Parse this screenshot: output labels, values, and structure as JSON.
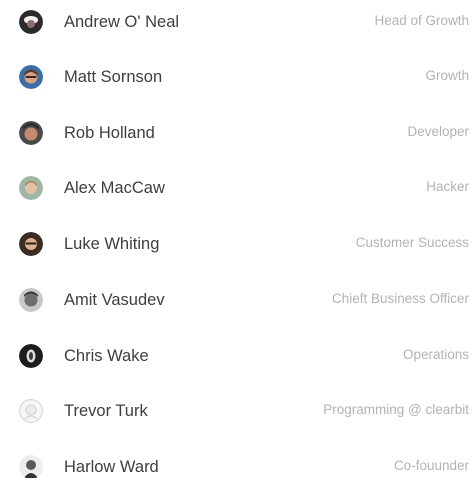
{
  "team": {
    "members": [
      {
        "name": "Andrew O' Neal",
        "role": "Head of Growth",
        "avatar_icon": "andrew-avatar"
      },
      {
        "name": "Matt Sornson",
        "role": "Growth",
        "avatar_icon": "matt-avatar"
      },
      {
        "name": "Rob Holland",
        "role": "Developer",
        "avatar_icon": "rob-avatar"
      },
      {
        "name": "Alex MacCaw",
        "role": "Hacker",
        "avatar_icon": "alex-avatar"
      },
      {
        "name": "Luke Whiting",
        "role": "Customer Success",
        "avatar_icon": "luke-avatar"
      },
      {
        "name": "Amit Vasudev",
        "role": "Chieft Business Officer",
        "avatar_icon": "amit-avatar"
      },
      {
        "name": "Chris Wake",
        "role": "Operations",
        "avatar_icon": "chris-avatar"
      },
      {
        "name": "Trevor Turk",
        "role": "Programming @ clearbit",
        "avatar_icon": "trevor-avatar"
      },
      {
        "name": "Harlow Ward",
        "role": "Co-fouunder",
        "avatar_icon": "harlow-avatar"
      }
    ]
  },
  "colors": {
    "name_text": "#3e3e3e",
    "role_text": "#b3b3b3",
    "background": "#ffffff"
  }
}
